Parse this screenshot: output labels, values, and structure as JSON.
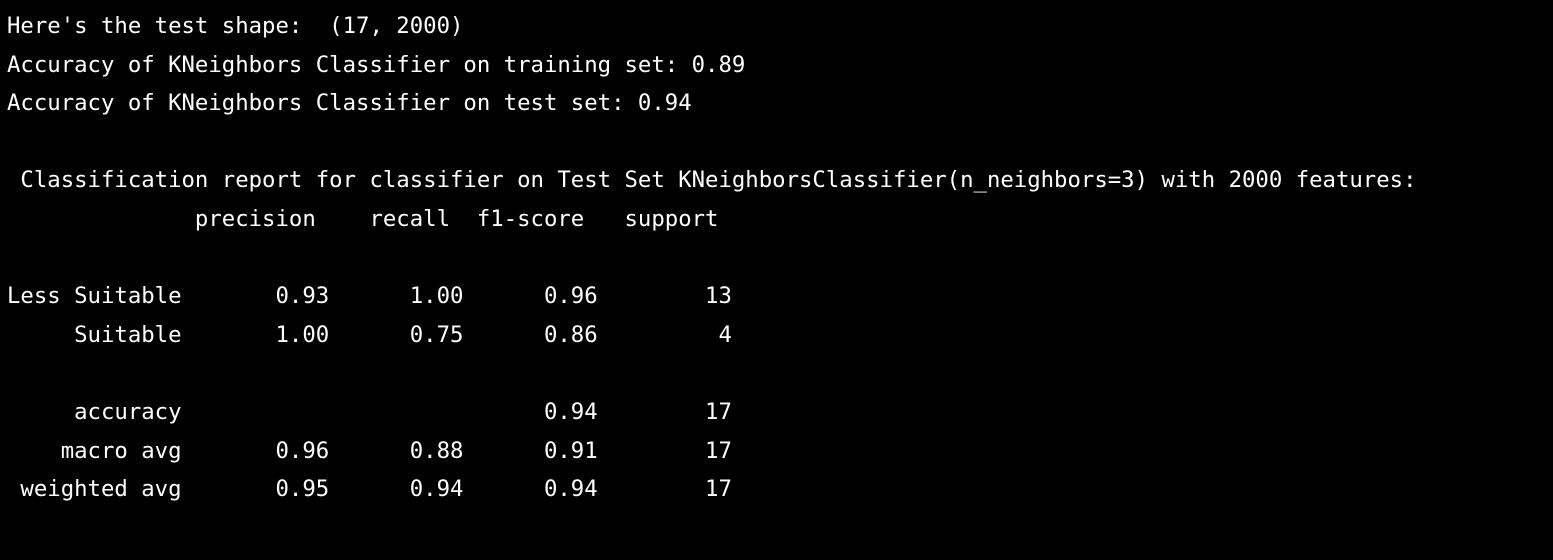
{
  "console": {
    "lines": [
      "Here's the test shape:  (17, 2000)",
      "Accuracy of KNeighbors Classifier on training set: 0.89",
      "Accuracy of KNeighbors Classifier on test set: 0.94",
      "",
      " Classification report for classifier on Test Set KNeighborsClassifier(n_neighbors=3) with 2000 features:",
      "              precision    recall  f1-score   support",
      "",
      "Less Suitable       0.93      1.00      0.96        13",
      "     Suitable       1.00      0.75      0.86         4",
      "",
      "     accuracy                           0.94        17",
      "    macro avg       0.96      0.88      0.91        17",
      " weighted avg       0.95      0.94      0.94        17"
    ]
  },
  "colors": {
    "background": "#000000",
    "text": "#ffffff"
  }
}
